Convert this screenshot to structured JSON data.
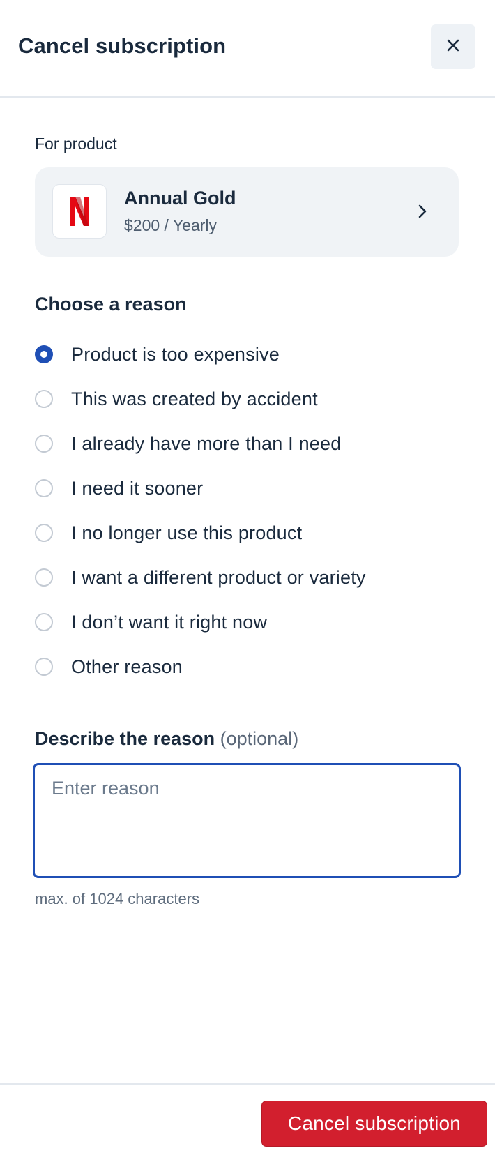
{
  "header": {
    "title": "Cancel subscription",
    "close_icon": "close-icon"
  },
  "product": {
    "section_label": "For product",
    "logo_icon": "netflix-logo-icon",
    "logo_color": "#e50914",
    "name": "Annual Gold",
    "price": "$200 / Yearly",
    "chevron_icon": "chevron-right-icon"
  },
  "reasons": {
    "heading": "Choose a reason",
    "selected_index": 0,
    "options": [
      "Product is too expensive",
      "This was created by accident",
      "I already have more than I need",
      "I need it sooner",
      "I no longer use this product",
      "I want a different product or variety",
      "I don’t want it right now",
      "Other reason"
    ]
  },
  "describe": {
    "label": "Describe the reason",
    "optional": "(optional)",
    "placeholder": "Enter reason",
    "value": "",
    "hint": "max. of 1024 characters"
  },
  "footer": {
    "submit_label": "Cancel subscription"
  },
  "colors": {
    "accent": "#1f4fb5",
    "danger": "#d21f2e",
    "text": "#1a2a3d",
    "muted": "#5f6d7e",
    "card_bg": "#f0f3f6"
  }
}
